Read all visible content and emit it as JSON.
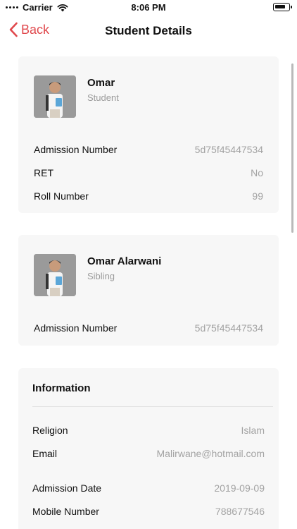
{
  "status_bar": {
    "carrier": "Carrier",
    "time": "8:06 PM"
  },
  "nav": {
    "back_label": "Back",
    "title": "Student Details"
  },
  "student": {
    "name": "Omar",
    "role": "Student",
    "rows": [
      {
        "label": "Admission Number",
        "value": "5d75f45447534"
      },
      {
        "label": "RET",
        "value": "No"
      },
      {
        "label": "Roll Number",
        "value": "99"
      }
    ]
  },
  "sibling": {
    "name": "Omar Alarwani",
    "role": "Sibling",
    "rows": [
      {
        "label": "Admission Number",
        "value": "5d75f45447534"
      }
    ]
  },
  "information": {
    "heading": "Information",
    "rows": [
      {
        "label": "Religion",
        "value": "Islam"
      },
      {
        "label": "Email",
        "value": "Malirwane@hotmail.com"
      },
      {
        "label": "Admission Date",
        "value": "2019-09-09"
      },
      {
        "label": "Mobile Number",
        "value": "788677546"
      }
    ]
  },
  "colors": {
    "accent": "#e0484c",
    "card_bg": "#f7f7f7",
    "muted_text": "#a3a3a3"
  }
}
